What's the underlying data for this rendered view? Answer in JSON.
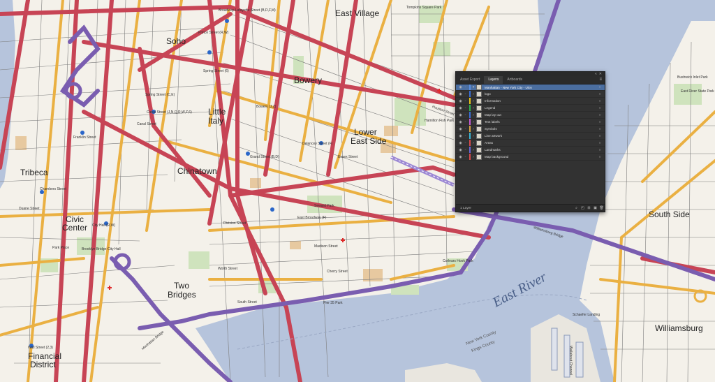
{
  "map": {
    "neighborhoods": [
      {
        "name": "East Village"
      },
      {
        "name": "Soho"
      },
      {
        "name": "Bowery"
      },
      {
        "name": "Little"
      },
      {
        "name": "Italy"
      },
      {
        "name": "Lower"
      },
      {
        "name": "East Side"
      },
      {
        "name": "Tribeca"
      },
      {
        "name": "Chinatown"
      },
      {
        "name": "Civic"
      },
      {
        "name": "Center"
      },
      {
        "name": "Two"
      },
      {
        "name": "Bridges"
      },
      {
        "name": "Financial"
      },
      {
        "name": "District"
      },
      {
        "name": "South Side"
      },
      {
        "name": "Williamsburg"
      }
    ],
    "water_label": "East River",
    "county_labels": [
      "New York County",
      "Kings County"
    ],
    "minor_labels": [
      "Broadway-Lafayette Street (B,D,F,M)",
      "Prince Street (R,W)",
      "Spring Street (6)",
      "Canal Street (J,N,Q,R,W,Z,6)",
      "Grand Street (B,D)",
      "East Broadway (F)",
      "Delancey Street (F)",
      "Chambers Street",
      "City Hall (R,W)",
      "Brooklyn Bridge-City Hall",
      "Park Place",
      "Wall Street (2,3)",
      "Pier 35 Park",
      "Corlears Hook Park",
      "Seward Park",
      "Hamilton Fish Park",
      "Tompkins Square Park",
      "Bushwick Inlet Park",
      "East River State Park",
      "Wallabout Channel",
      "Schaefer Landing",
      "Manhattan Bridge",
      "Williamsburg Bridge",
      "Canal Street",
      "Franklin Street",
      "Houston Street",
      "Division Street",
      "Madison Street",
      "Cherry Street",
      "South Street",
      "Bowery (J,Z)",
      "Spring Street (C,E)",
      "Essex Street",
      "Worth Street",
      "Duane Street"
    ]
  },
  "panel": {
    "tabs": [
      "Asset Export",
      "Layers",
      "Artboards"
    ],
    "active_tab": "Layers",
    "parent_layer": "Manhattan - New York City - USA",
    "layers": [
      {
        "name": "logo",
        "color": "#3a6fd8"
      },
      {
        "name": "Information",
        "color": "#e8c41a"
      },
      {
        "name": "Legend",
        "color": "#2fb44c"
      },
      {
        "name": "Map lay out",
        "color": "#3a6fd8"
      },
      {
        "name": "Text labels",
        "color": "#c75bd6"
      },
      {
        "name": "Symbols",
        "color": "#d9a441"
      },
      {
        "name": "Line artwork",
        "color": "#3bb6d6"
      },
      {
        "name": "Areas",
        "color": "#d84a4a"
      },
      {
        "name": "Landmarks",
        "color": "#6b66d6"
      },
      {
        "name": "Map background",
        "color": "#d84a4a"
      }
    ],
    "parent_color": "#5b8fe0",
    "footer_count": "1 Layer",
    "footer_icons": [
      "search-icon",
      "make-clipping-mask-icon",
      "new-sublayer-icon",
      "new-layer-icon",
      "delete-icon"
    ]
  }
}
